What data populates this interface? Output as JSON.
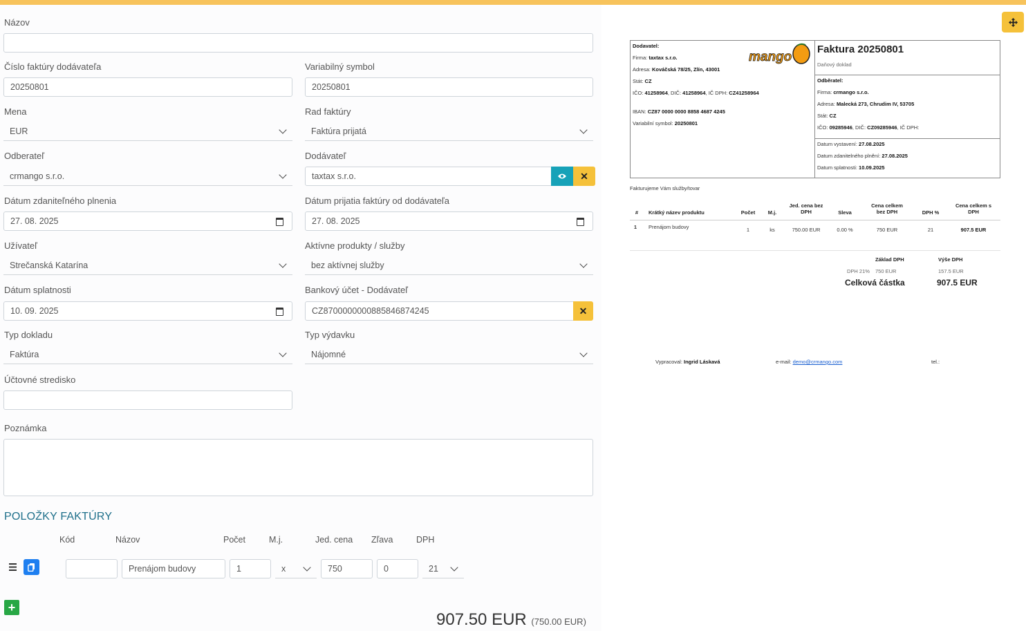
{
  "form": {
    "nazov": {
      "label": "Názov",
      "value": ""
    },
    "cislo_faktury": {
      "label": "Číslo faktúry dodávateľa",
      "value": "20250801"
    },
    "variabilny_symbol": {
      "label": "Variabilný symbol",
      "value": "20250801"
    },
    "mena": {
      "label": "Mena",
      "value": "EUR"
    },
    "rad_faktury": {
      "label": "Rad faktúry",
      "value": "Faktúra prijatá"
    },
    "odberatel": {
      "label": "Odberateľ",
      "value": "crmango s.r.o."
    },
    "dodavatel": {
      "label": "Dodávateľ",
      "value": "taxtax s.r.o."
    },
    "datum_zdanitelneho": {
      "label": "Dátum zdaniteľného plnenia",
      "value": "27. 08. 2025"
    },
    "datum_prijatia": {
      "label": "Dátum prijatia faktúry od dodávateľa",
      "value": "27. 08. 2025"
    },
    "uzivatel": {
      "label": "Užívateľ",
      "value": "Strečanská Katarína"
    },
    "aktivne_produkty": {
      "label": "Aktívne produkty / služby",
      "value": "bez aktívnej služby"
    },
    "datum_splatnosti": {
      "label": "Dátum splatnosti",
      "value": "10. 09. 2025"
    },
    "bankovy_ucet": {
      "label": "Bankový účet - Dodávateľ",
      "value": "CZ8700000000885846874245"
    },
    "typ_dokladu": {
      "label": "Typ dokladu",
      "value": "Faktúra"
    },
    "typ_vydavku": {
      "label": "Typ výdavku",
      "value": "Nájomné"
    },
    "uctovne_stredisko": {
      "label": "Účtovné stredisko",
      "value": ""
    },
    "poznamka": {
      "label": "Poznámka",
      "value": ""
    }
  },
  "items": {
    "title": "POLOŽKY FAKTÚRY",
    "headers": {
      "kod": "Kód",
      "nazov": "Názov",
      "pocet": "Počet",
      "mj": "M.j.",
      "jed_cena": "Jed. cena",
      "zlava": "Zľava",
      "dph": "DPH"
    },
    "rows": [
      {
        "kod": "",
        "nazov": "Prenájom budovy",
        "pocet": "1",
        "mj": "x",
        "jed_cena": "750",
        "zlava": "0",
        "dph": "21"
      }
    ],
    "add_label": "+"
  },
  "totals": {
    "total": "907.50 EUR",
    "net": "(750.00 EUR)"
  },
  "icons": {
    "move": "move-arrows-icon",
    "eye": "eye-icon",
    "clear": "close-icon",
    "copy": "copy-icon",
    "drag": "hamburger-icon",
    "add": "plus-icon",
    "calendar": "calendar-icon",
    "chevron": "chevron-down-icon"
  },
  "colors": {
    "accent_yellow": "#f5c13a",
    "top_bar": "#f7c35c",
    "teal": "#17a2b8",
    "add_green": "#28a745",
    "copy_blue": "#1e7ff0",
    "section_title": "#1e6f8a"
  },
  "invoice": {
    "title": "Faktura 20250801",
    "subtitle": "Daňový doklad",
    "logo_text": "mango",
    "supplier": {
      "heading": "Dodavatel:",
      "firma_label": "Firma:",
      "firma": "taxtax s.r.o.",
      "adresa_label": "Adresa:",
      "adresa": "Kováčská 78/25, Zlín, 43001",
      "stat_label": "Stát:",
      "stat": "CZ",
      "ico_label": "IČO:",
      "ico": "41258964",
      "dic_label": ", DIČ:",
      "dic": "41258964",
      "icdph_label": ", IČ DPH:",
      "icdph": "CZ41258964",
      "iban_label": "IBAN:",
      "iban": "CZ87 0000 0000 8858 4687 4245",
      "vs_label": "Variabilní symbol:",
      "vs": "20250801"
    },
    "customer": {
      "heading": "Odběratel:",
      "firma_label": "Firma:",
      "firma": "crmango s.r.o.",
      "adresa_label": "Adresa:",
      "adresa": "Malecká 273, Chrudim IV, 53705",
      "stat_label": "Stát:",
      "stat": "CZ",
      "ico_label": "IČO:",
      "ico": "09285946",
      "dic_label": ", DIČ:",
      "dic": "CZ09285946",
      "icdph_label": ", IČ DPH:"
    },
    "dates": {
      "vystaveni_label": "Datum vystavení:",
      "vystaveni": "27.08.2025",
      "zdanitelne_label": "Datum zdanitelného plnění:",
      "zdanitelne": "27.08.2025",
      "splatnost_label": "Datum splatnosti:",
      "splatnost": "10.09.2025"
    },
    "intro": "Fakturujeme Vám služby/tovar",
    "table_headers": {
      "num": "#",
      "name": "Krátký název produktu",
      "count": "Počet",
      "mj": "M.j.",
      "unit": "Jed. cena bez DPH",
      "discount": "Sleva",
      "total_net": "Cena celkem bez DPH",
      "vat": "DPH %",
      "total_gross": "Cena celkem s DPH"
    },
    "rows": [
      {
        "num": "1",
        "name": "Prenájom budovy",
        "count": "1",
        "mj": "ks",
        "unit": "750.00 EUR",
        "discount": "0.00 %",
        "total_net": "750 EUR",
        "vat": "21",
        "total_gross": "907.5 EUR"
      }
    ],
    "summary": {
      "base_label": "Základ DPH",
      "vat_label": "Výše DPH",
      "rate_label": "DPH 21%",
      "base_value": "750 EUR",
      "vat_value": "157.5 EUR",
      "total_label": "Celková částka",
      "total_value": "907.5 EUR"
    },
    "footer": {
      "issued_label": "Vypracoval:",
      "issued_by": "Ingrid Láskavá",
      "email_label": "e-mail:",
      "email": "demo@crmango.com",
      "tel_label": "tel.:"
    }
  }
}
